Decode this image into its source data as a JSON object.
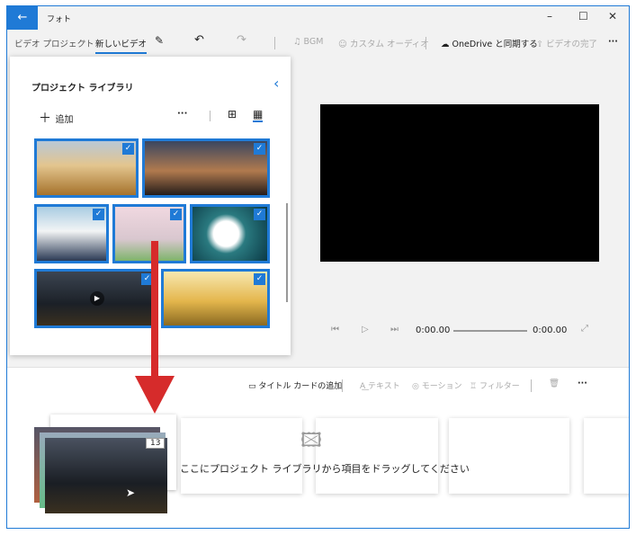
{
  "window": {
    "title": "フォト",
    "back_icon": "arrow-left-icon",
    "minimize": "–",
    "maximize": "☐",
    "close": "✕"
  },
  "toolbar": {
    "breadcrumb_root": "ビデオ プロジェクト",
    "breadcrumb_current": "新しいビデオ",
    "bgm": "BGM",
    "custom_audio": "カスタム オーディオ",
    "onedrive_sync": "OneDrive と同期する",
    "finish_video": "ビデオの完了",
    "more": "···"
  },
  "library": {
    "title": "プロジェクト ライブラリ",
    "add": "追加",
    "more": "···",
    "collapse": "‹"
  },
  "playback": {
    "current_time": "0:00.00",
    "total_time": "0:00.00"
  },
  "storyboard": {
    "add_title_card": "タイトル カードの追加",
    "text": "テキスト",
    "motion": "モーション",
    "filter": "フィルター",
    "more": "···",
    "drop_hint": "ここにプロジェクト ライブラリから項目をドラッグしてください",
    "drag_count": "13"
  },
  "colors": {
    "accent": "#1f7ad6",
    "arrow": "#d62b2b"
  }
}
